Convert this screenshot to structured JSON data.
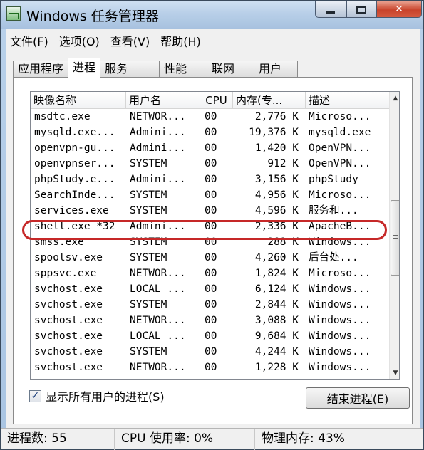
{
  "window": {
    "title": "Windows 任务管理器",
    "controls": {
      "minimize": "minimize-icon",
      "maximize": "maximize-icon",
      "close": "✕"
    }
  },
  "menu": [
    "文件(F)",
    "选项(O)",
    "查看(V)",
    "帮助(H)"
  ],
  "tabs": [
    {
      "label": "应用程序",
      "active": false
    },
    {
      "label": "进程",
      "active": true
    },
    {
      "label": "服务",
      "active": false
    },
    {
      "label": "性能",
      "active": false
    },
    {
      "label": "联网",
      "active": false
    },
    {
      "label": "用户",
      "active": false
    }
  ],
  "columns": [
    "映像名称",
    "用户名",
    "CPU",
    "内存(专...",
    "描述"
  ],
  "processes": [
    {
      "name": "msdtc.exe",
      "user": "NETWOR...",
      "cpu": "00",
      "memory": "2,776 K",
      "description": "Microso..."
    },
    {
      "name": "mysqld.exe...",
      "user": "Admini...",
      "cpu": "00",
      "memory": "19,376 K",
      "description": "mysqld.exe"
    },
    {
      "name": "openvpn-gu...",
      "user": "Admini...",
      "cpu": "00",
      "memory": "1,420 K",
      "description": "OpenVPN..."
    },
    {
      "name": "openvpnser...",
      "user": "SYSTEM",
      "cpu": "00",
      "memory": "912 K",
      "description": "OpenVPN..."
    },
    {
      "name": "phpStudy.e...",
      "user": "Admini...",
      "cpu": "00",
      "memory": "3,156 K",
      "description": "phpStudy"
    },
    {
      "name": "SearchInde...",
      "user": "SYSTEM",
      "cpu": "00",
      "memory": "4,956 K",
      "description": "Microso..."
    },
    {
      "name": "services.exe",
      "user": "SYSTEM",
      "cpu": "00",
      "memory": "4,596 K",
      "description": "服务和..."
    },
    {
      "name": "shell.exe *32",
      "user": "Admini...",
      "cpu": "00",
      "memory": "2,336 K",
      "description": "ApacheB..."
    },
    {
      "name": "smss.exe",
      "user": "SYSTEM",
      "cpu": "00",
      "memory": "288 K",
      "description": "Windows..."
    },
    {
      "name": "spoolsv.exe",
      "user": "SYSTEM",
      "cpu": "00",
      "memory": "4,260 K",
      "description": "后台处..."
    },
    {
      "name": "sppsvc.exe",
      "user": "NETWOR...",
      "cpu": "00",
      "memory": "1,824 K",
      "description": "Microso..."
    },
    {
      "name": "svchost.exe",
      "user": "LOCAL ...",
      "cpu": "00",
      "memory": "6,124 K",
      "description": "Windows..."
    },
    {
      "name": "svchost.exe",
      "user": "SYSTEM",
      "cpu": "00",
      "memory": "2,844 K",
      "description": "Windows..."
    },
    {
      "name": "svchost.exe",
      "user": "NETWOR...",
      "cpu": "00",
      "memory": "3,088 K",
      "description": "Windows..."
    },
    {
      "name": "svchost.exe",
      "user": "LOCAL ...",
      "cpu": "00",
      "memory": "9,684 K",
      "description": "Windows..."
    },
    {
      "name": "svchost.exe",
      "user": "SYSTEM",
      "cpu": "00",
      "memory": "4,244 K",
      "description": "Windows..."
    },
    {
      "name": "svchost.exe",
      "user": "NETWOR...",
      "cpu": "00",
      "memory": "1,228 K",
      "description": "Windows..."
    }
  ],
  "highlighted_process": "shell.exe *32",
  "show_all_users": {
    "label": "显示所有用户的进程(S)",
    "checked": true
  },
  "end_process_button": "结束进程(E)",
  "status": {
    "processes": "进程数: 55",
    "cpu_usage": "CPU 使用率: 0%",
    "physical_memory": "物理内存: 43%"
  },
  "colors": {
    "highlight_ring": "#c62828",
    "title_bar": "#b8cfe8",
    "close_button": "#c8432b"
  }
}
